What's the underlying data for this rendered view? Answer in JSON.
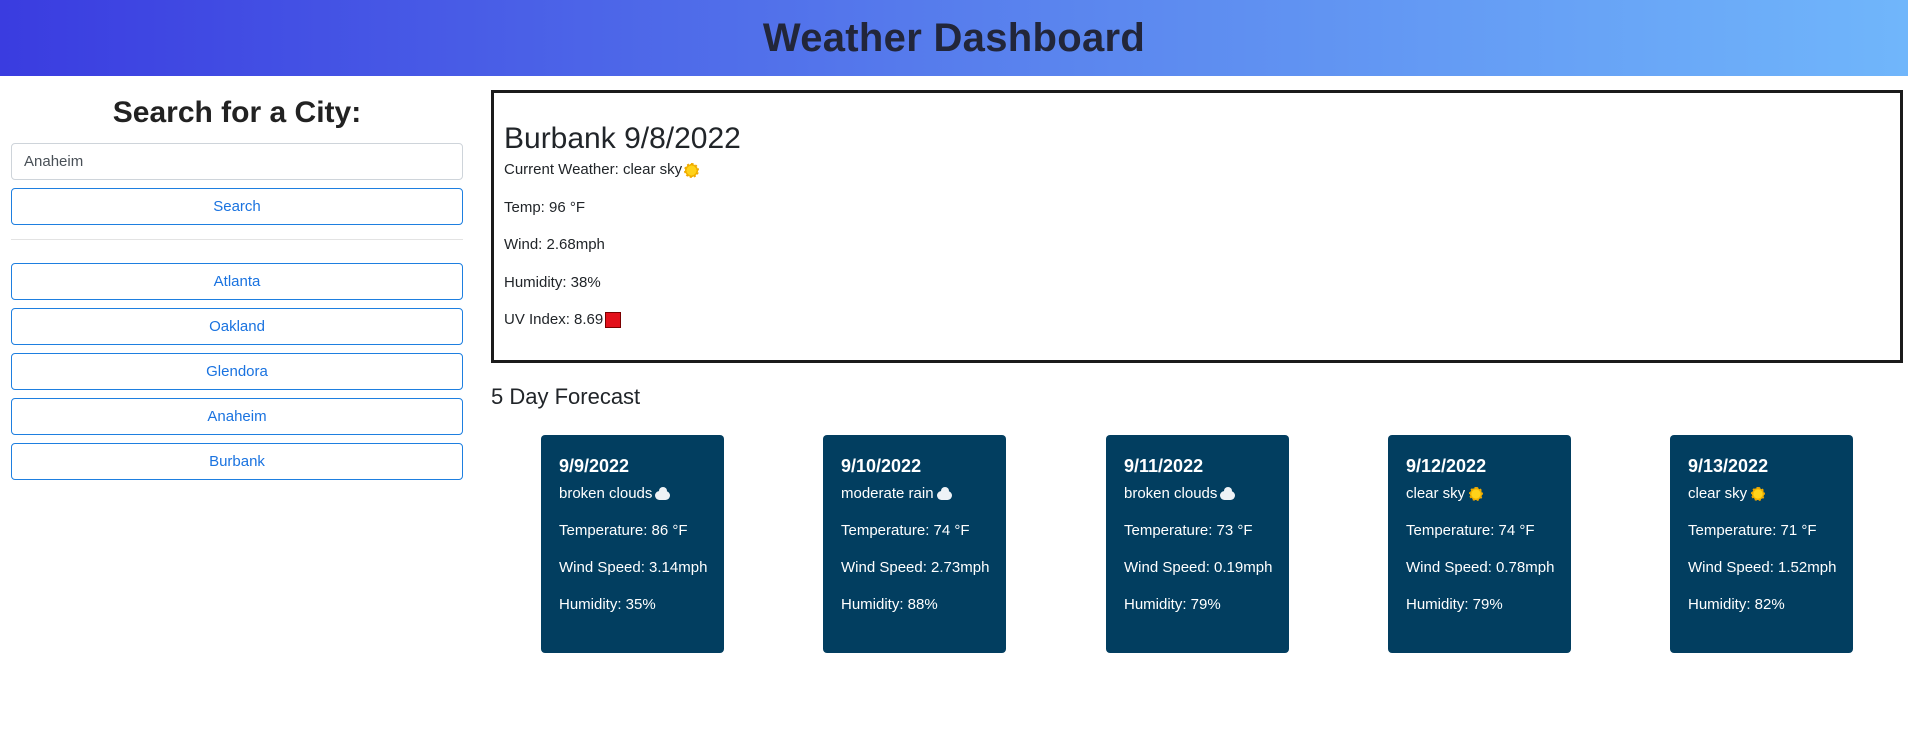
{
  "header": {
    "title": "Weather Dashboard"
  },
  "search": {
    "heading": "Search for a City:",
    "input_value": "Anaheim",
    "button_label": "Search"
  },
  "history": [
    {
      "label": "Atlanta"
    },
    {
      "label": "Oakland"
    },
    {
      "label": "Glendora"
    },
    {
      "label": "Anaheim"
    },
    {
      "label": "Burbank"
    }
  ],
  "current": {
    "title": "Burbank 9/8/2022",
    "weather": "Current Weather: clear sky",
    "weather_icon": "sun-icon",
    "temp": "Temp: 96 °F",
    "wind": "Wind: 2.68mph",
    "humidity": "Humidity: 38%",
    "uv": "UV Index: 8.69",
    "uv_color": "#e3101a"
  },
  "forecast": {
    "title": "5 Day Forecast",
    "days": [
      {
        "date": "9/9/2022",
        "condition": "broken clouds",
        "icon": "cloud-icon",
        "temp": "Temperature: 86 °F",
        "wind": "Wind Speed: 3.14mph",
        "humidity": "Humidity: 35%"
      },
      {
        "date": "9/10/2022",
        "condition": "moderate rain",
        "icon": "cloud-icon",
        "temp": "Temperature: 74 °F",
        "wind": "Wind Speed: 2.73mph",
        "humidity": "Humidity: 88%"
      },
      {
        "date": "9/11/2022",
        "condition": "broken clouds",
        "icon": "cloud-icon",
        "temp": "Temperature: 73 °F",
        "wind": "Wind Speed: 0.19mph",
        "humidity": "Humidity: 79%"
      },
      {
        "date": "9/12/2022",
        "condition": "clear sky",
        "icon": "sun-icon",
        "temp": "Temperature: 74 °F",
        "wind": "Wind Speed: 0.78mph",
        "humidity": "Humidity: 79%"
      },
      {
        "date": "9/13/2022",
        "condition": "clear sky",
        "icon": "sun-icon",
        "temp": "Temperature: 71 °F",
        "wind": "Wind Speed: 1.52mph",
        "humidity": "Humidity: 82%"
      }
    ]
  },
  "colors": {
    "card_bg": "#023e60",
    "button_border": "#1e7fe0",
    "header_gradient_start": "#3a3ce0",
    "header_gradient_end": "#70b6fb"
  }
}
